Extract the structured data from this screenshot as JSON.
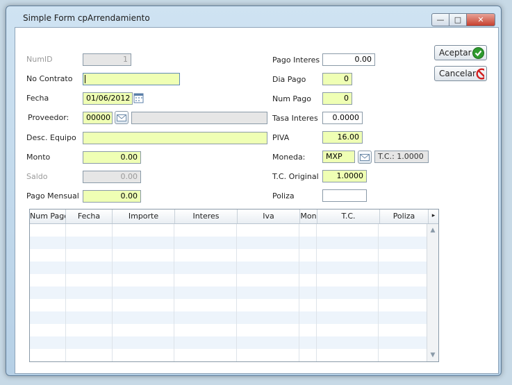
{
  "window": {
    "title": "Simple Form cpArrendamiento"
  },
  "buttons": {
    "accept": "Aceptar",
    "cancel": "Cancelar"
  },
  "left_form": {
    "numid": {
      "label": "NumID",
      "value": "1"
    },
    "contrato": {
      "label": "No Contrato",
      "value": ""
    },
    "fecha": {
      "label": "Fecha",
      "value": "01/06/2012"
    },
    "proveedor": {
      "label": "Proveedor:",
      "code": "00000",
      "name": ""
    },
    "equipo": {
      "label": "Desc. Equipo",
      "value": ""
    },
    "monto": {
      "label": "Monto",
      "value": "0.00"
    },
    "saldo": {
      "label": "Saldo",
      "value": "0.00"
    },
    "pago_mensual": {
      "label": "Pago Mensual",
      "value": "0.00"
    }
  },
  "right_form": {
    "pago_interes": {
      "label": "Pago Interes",
      "value": "0.00"
    },
    "dia_pago": {
      "label": "Dia Pago",
      "value": "0"
    },
    "num_pago": {
      "label": "Num Pago",
      "value": "0"
    },
    "tasa_interes": {
      "label": "Tasa Interes",
      "value": "0.0000"
    },
    "piva": {
      "label": "PIVA",
      "value": "16.00"
    },
    "moneda": {
      "label": "Moneda:",
      "value": "MXP",
      "tc": "T.C.: 1.0000"
    },
    "tc_original": {
      "label": "T.C. Original",
      "value": "1.0000"
    },
    "poliza": {
      "label": "Poliza",
      "value": ""
    }
  },
  "grid": {
    "columns": [
      "Num Pago",
      "Fecha",
      "Importe",
      "Interes",
      "Iva",
      "Mon",
      "T.C.",
      "Poliza"
    ],
    "more_arrow": "▸"
  }
}
